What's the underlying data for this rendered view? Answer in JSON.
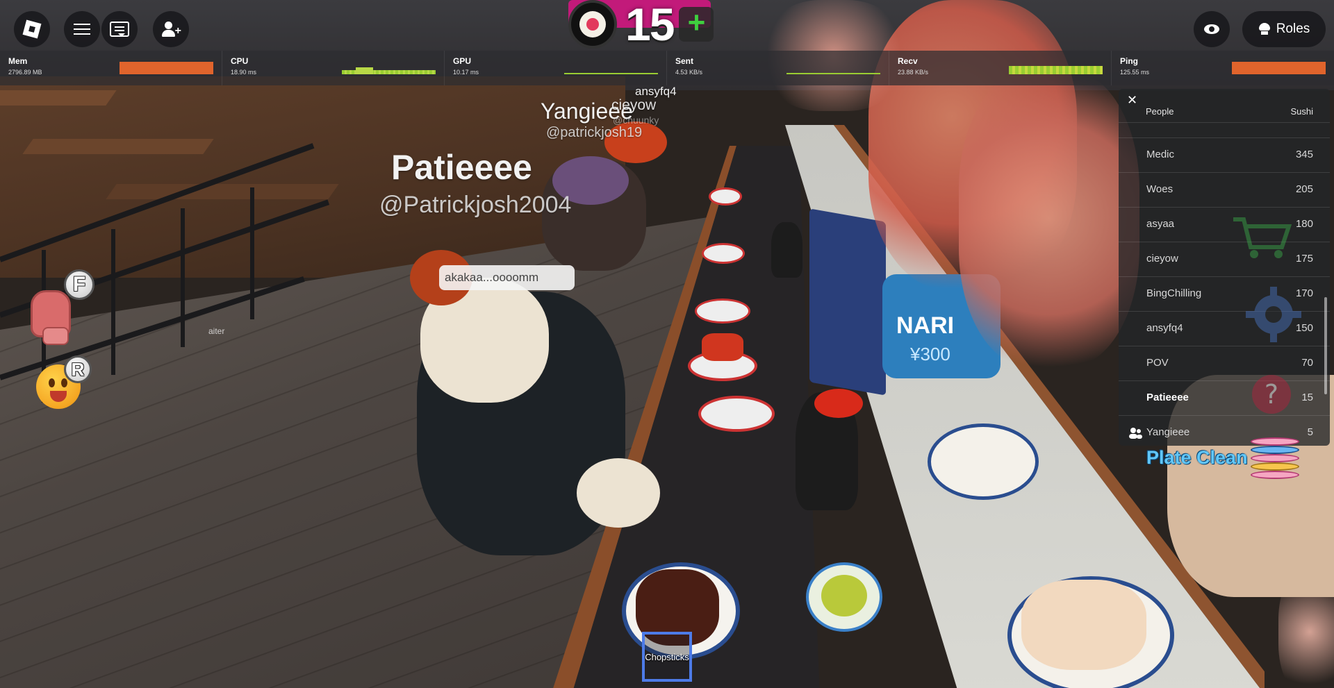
{
  "topbar": {
    "menu_icon": "roblox-logo-icon",
    "sushi_count": "15",
    "sushi_add": "+",
    "roles_label": "Roles"
  },
  "stats": [
    {
      "label": "Mem",
      "value": "2796.89 MB",
      "color": "#e0642c"
    },
    {
      "label": "CPU",
      "value": "18.90 ms",
      "color": "#9acd32"
    },
    {
      "label": "GPU",
      "value": "10.17 ms",
      "color": "#9acd32"
    },
    {
      "label": "Sent",
      "value": "4.53 KB/s",
      "color": "#9acd32"
    },
    {
      "label": "Recv",
      "value": "23.88 KB/s",
      "color": "#9acd32"
    },
    {
      "label": "Ping",
      "value": "125.55 ms",
      "color": "#e0642c"
    }
  ],
  "nametags": {
    "p1_name": "Patieeee",
    "p1_handle": "@Patrickjosh2004",
    "p2_name": "Yangieee",
    "p2_handle": "@patrickjosh19",
    "p3_name": "cieyow",
    "p3_handle": "@chuunky",
    "p4_name": "ansyfq4"
  },
  "chat_bubble": "akakaa...oooomm",
  "side_buttons": {
    "backpack_key": "F",
    "emote_key": "R"
  },
  "waiter_label": "aiter",
  "scene_sign": {
    "brand": "NARI",
    "price": "¥300"
  },
  "leaderboard": {
    "col_people": "People",
    "col_sushi": "Sushi",
    "rows": [
      {
        "name": "Medic",
        "value": "345"
      },
      {
        "name": "Woes",
        "value": "205"
      },
      {
        "name": "asyaa",
        "value": "180"
      },
      {
        "name": "cieyow",
        "value": "175"
      },
      {
        "name": "BingChilling",
        "value": "170"
      },
      {
        "name": "ansyfq4",
        "value": "150"
      },
      {
        "name": "POV",
        "value": "70"
      },
      {
        "name": "Patieeee",
        "value": "15"
      },
      {
        "name": "Yangieee",
        "value": "5"
      }
    ]
  },
  "plate_clean": "Plate Clean",
  "hotbar": {
    "slot1": "Chopsticks"
  }
}
